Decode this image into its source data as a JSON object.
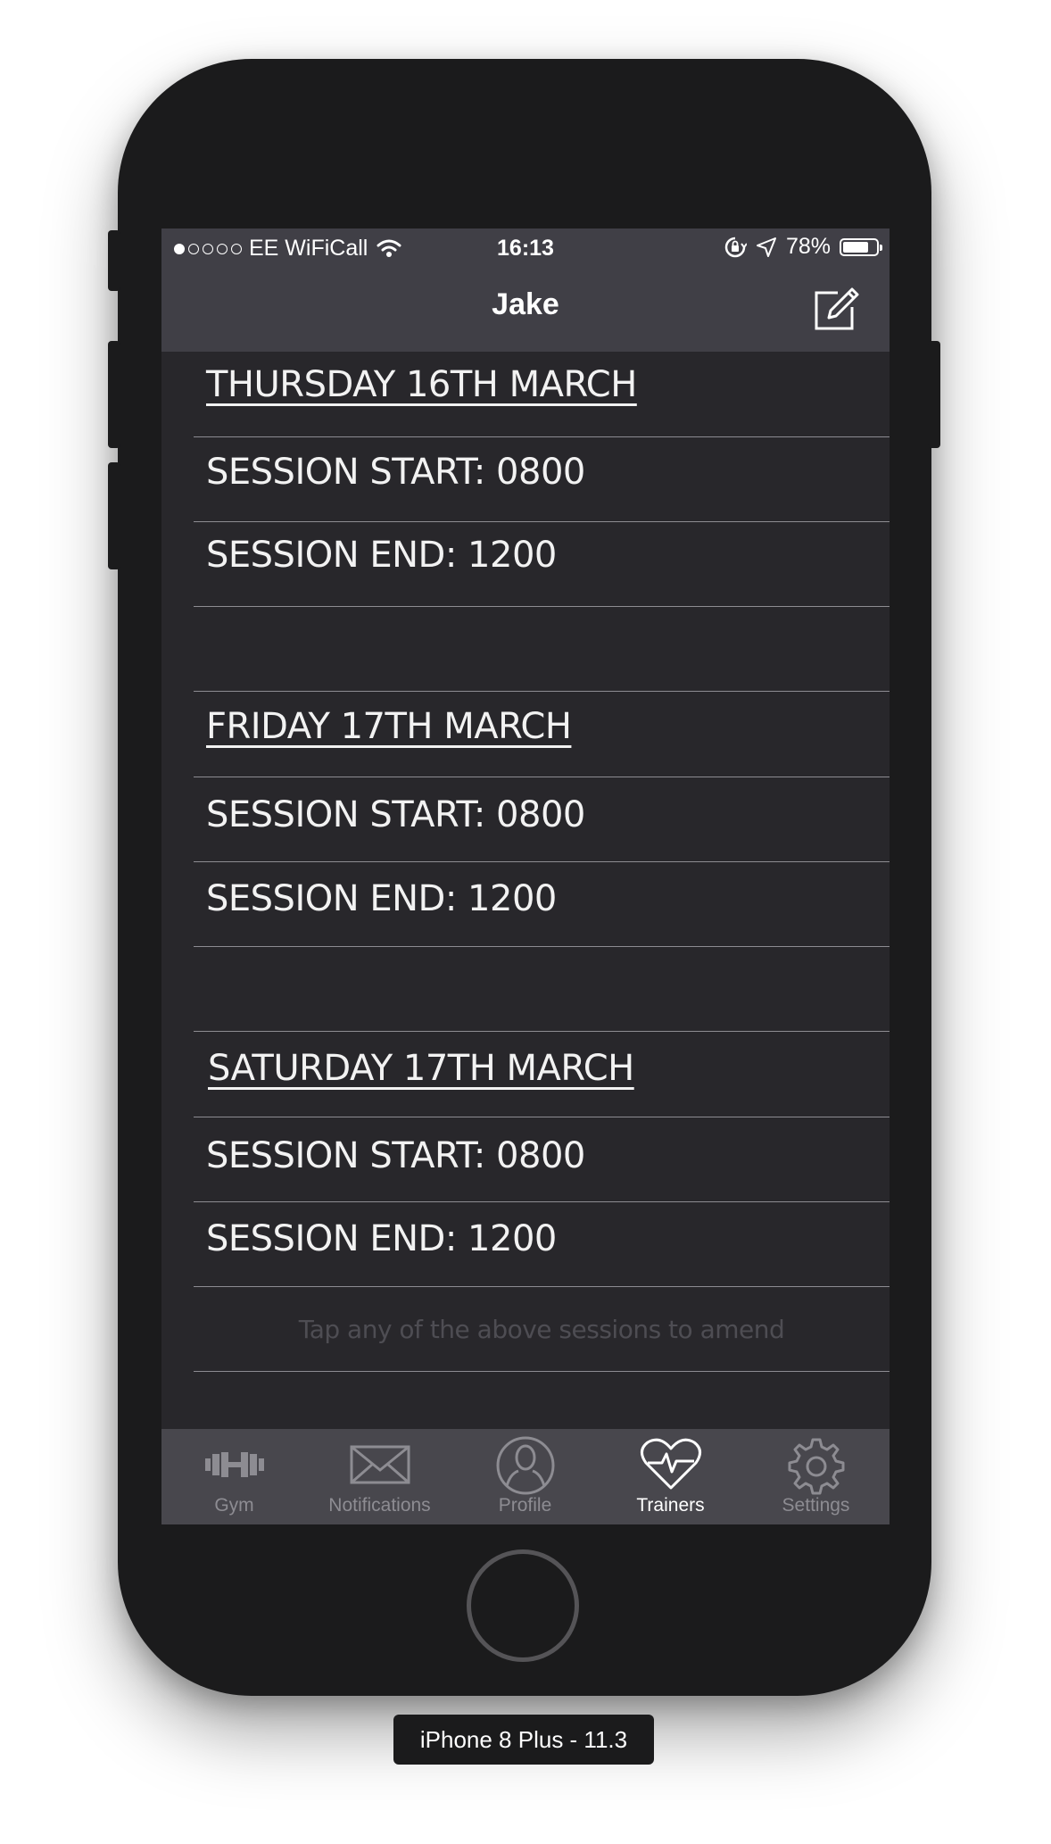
{
  "status_bar": {
    "carrier": "EE WiFiCall",
    "time": "16:13",
    "battery": "78%",
    "battery_level": 0.78
  },
  "nav": {
    "title": "Jake",
    "edit_icon": "compose-icon"
  },
  "schedule": {
    "days": [
      {
        "date": "THURSDAY 16TH MARCH",
        "start": "SESSION START: 0800",
        "end": "SESSION END: 1200"
      },
      {
        "date": "FRIDAY 17TH MARCH",
        "start": "SESSION START: 0800",
        "end": "SESSION END: 1200"
      },
      {
        "date": "SATURDAY 17TH MARCH",
        "start": "SESSION START: 0800",
        "end": "SESSION END: 1200"
      }
    ],
    "hint": "Tap any of the above sessions to amend"
  },
  "tabbar": {
    "tabs": [
      {
        "label": "Gym",
        "icon": "dumbbell-icon"
      },
      {
        "label": "Notifications",
        "icon": "envelope-icon"
      },
      {
        "label": "Profile",
        "icon": "person-icon"
      },
      {
        "label": "Trainers",
        "icon": "heartbeat-icon",
        "active": true
      },
      {
        "label": "Settings",
        "icon": "gear-icon"
      }
    ]
  },
  "simulator_label": "iPhone 8 Plus - 11.3",
  "colors": {
    "screen_bg": "#28272b",
    "bar_bg": "#403f46",
    "tab_bg": "#48474d",
    "text": "#f2f2f2"
  }
}
